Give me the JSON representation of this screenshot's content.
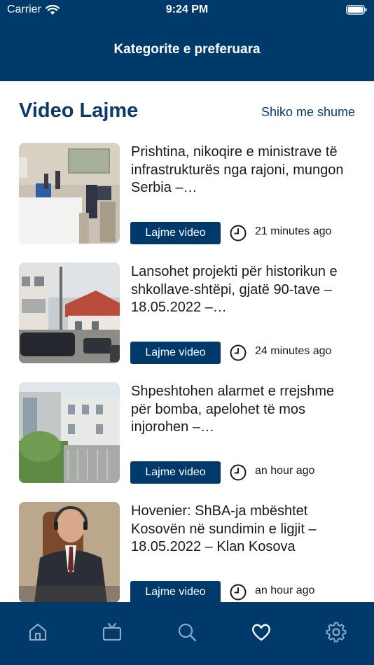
{
  "status_bar": {
    "carrier": "Carrier",
    "time": "9:24 PM"
  },
  "header": {
    "title": "Kategorite e preferuara"
  },
  "section": {
    "title": "Video Lajme",
    "see_more": "Shiko me shume"
  },
  "news": [
    {
      "headline": "Prishtina, nikoqire e ministrave të infrastrukturës nga rajoni, mungon Serbia –…",
      "category": "Lajme video",
      "time_ago": "21 minutes ago"
    },
    {
      "headline": "Lansohet projekti për historikun e shkollave-shtëpi, gjatë 90-tave – 18.05.2022 –…",
      "category": "Lajme video",
      "time_ago": "24 minutes ago"
    },
    {
      "headline": "Shpeshtohen alarmet e rrejshme për bomba, apelohet të mos injorohen –…",
      "category": "Lajme video",
      "time_ago": "an hour ago"
    },
    {
      "headline": "Hovenier: ShBA-ja mbështet Kosovën në sundimin e ligjit – 18.05.2022 – Klan Kosova",
      "category": "Lajme video",
      "time_ago": "an hour ago"
    }
  ],
  "tabbar": {
    "tabs": [
      "home-icon",
      "tv-icon",
      "search-icon",
      "heart-icon",
      "settings-icon"
    ],
    "active": "heart-icon"
  },
  "colors": {
    "primary": "#003a6b",
    "text": "#1a1a1a",
    "background": "#ffffff"
  }
}
